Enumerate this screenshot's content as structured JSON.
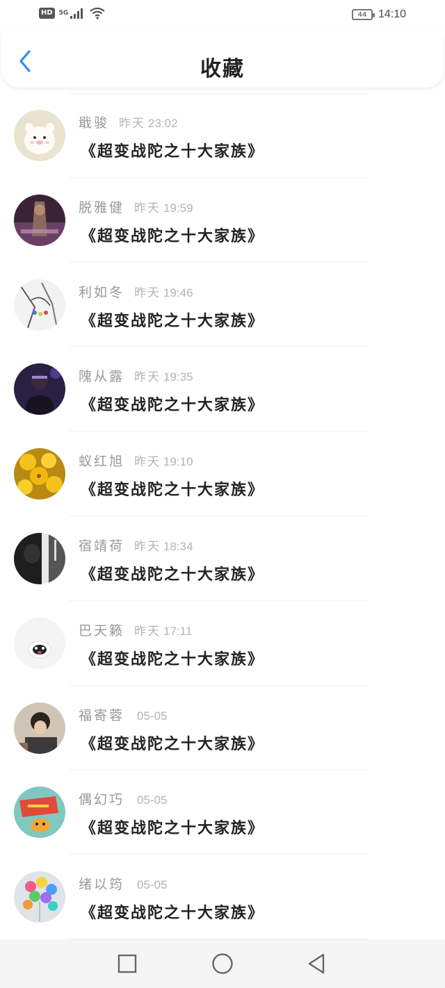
{
  "status_bar": {
    "hd_badge": "HD",
    "network": "5G",
    "battery": "44",
    "time": "14:10"
  },
  "header": {
    "title": "收藏",
    "back_icon": "chevron-left-icon",
    "accent_color": "#2f8cf2"
  },
  "list": {
    "items": [
      {
        "name": "戢骏",
        "day": "昨天",
        "time": "23:02",
        "book": "《超变战陀之十大家族》"
      },
      {
        "name": "脱雅健",
        "day": "昨天",
        "time": "19:59",
        "book": "《超变战陀之十大家族》"
      },
      {
        "name": "利如冬",
        "day": "昨天",
        "time": "19:46",
        "book": "《超变战陀之十大家族》"
      },
      {
        "name": "隗从露",
        "day": "昨天",
        "time": "19:35",
        "book": "《超变战陀之十大家族》"
      },
      {
        "name": "蚁红旭",
        "day": "昨天",
        "time": "19:10",
        "book": "《超变战陀之十大家族》"
      },
      {
        "name": "宿靖荷",
        "day": "昨天",
        "time": "18:34",
        "book": "《超变战陀之十大家族》"
      },
      {
        "name": "巴天籁",
        "day": "昨天",
        "time": "17:11",
        "book": "《超变战陀之十大家族》"
      },
      {
        "name": "福寄蓉",
        "day": "",
        "time": "05-05",
        "book": "《超变战陀之十大家族》"
      },
      {
        "name": "偶幻巧",
        "day": "",
        "time": "05-05",
        "book": "《超变战陀之十大家族》"
      },
      {
        "name": "绪以筠",
        "day": "",
        "time": "05-05",
        "book": "《超变战陀之十大家族》"
      }
    ]
  },
  "nav_bar": {
    "recent_icon": "square-icon",
    "home_icon": "circle-icon",
    "back_icon": "triangle-back-icon"
  }
}
